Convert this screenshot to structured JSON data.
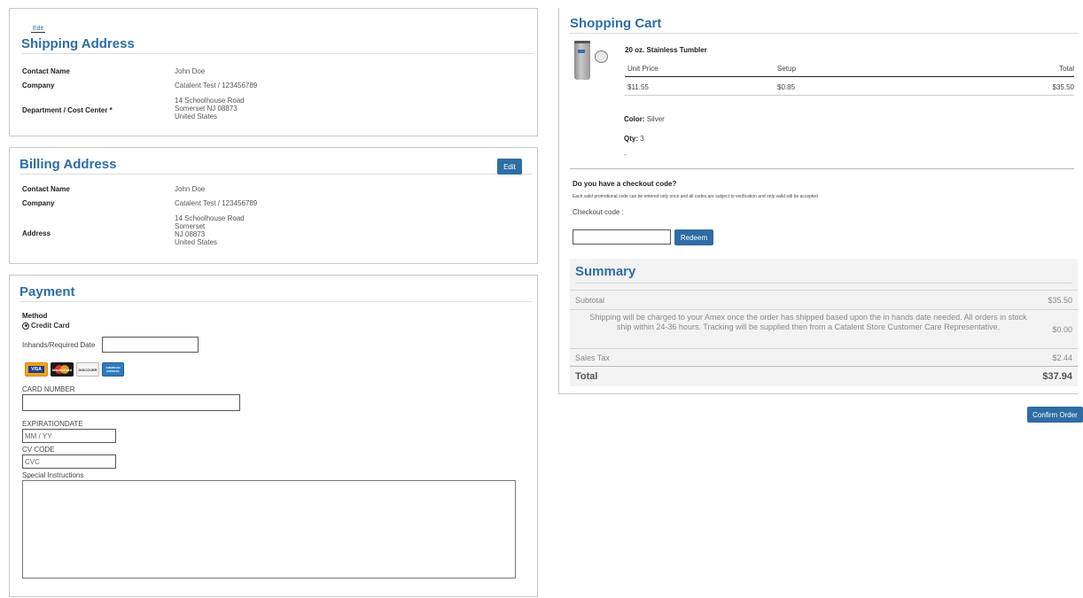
{
  "shipping": {
    "edit_label": "Edit",
    "title": "Shipping Address",
    "contact_label": "Contact Name",
    "contact_value": "John Doe",
    "company_label": "Company",
    "company_value": "Catalent Test / 123456789",
    "dept_label": "Department / Cost Center *",
    "address_lines": [
      "14 Schoolhouse Road",
      "Somerset NJ 08873",
      "United States"
    ]
  },
  "billing": {
    "title": "Billing Address",
    "edit_label": "Edit",
    "contact_label": "Contact Name",
    "contact_value": "John Doe",
    "company_label": "Company",
    "company_value": "Catalent Test / 123456789",
    "address_label": "Address",
    "address_lines": [
      "14 Schoolhouse Road",
      "Somerset",
      "NJ 08873",
      "United States"
    ]
  },
  "payment": {
    "title": "Payment",
    "method_label": "Method",
    "method_value": "Credit Card",
    "inhands_label": "Inhands/Required Date",
    "cards": [
      "VISA",
      "MasterCard",
      "DISCOVER",
      "AMERICAN EXPRESS"
    ],
    "card_number_label": "CARD NUMBER",
    "expiration_label": "EXPIRATIONDATE",
    "expiration_placeholder": "MM / YY",
    "cv_label": "CV CODE",
    "cv_placeholder": "CVC",
    "instructions_label": "Special Instructions"
  },
  "cart": {
    "title": "Shopping Cart",
    "product_name": "20 oz. Stainless Tumbler",
    "col_unit": "Unit Price",
    "col_setup": "Setup",
    "col_total": "Total",
    "unit_price": "$11.55",
    "setup": "$0.85",
    "total": "$35.50",
    "color_label": "Color:",
    "color_value": "Silver",
    "qty_label": "Qty:",
    "qty_value": "3",
    "dash": "-",
    "checkout_question": "Do you have a checkout code?",
    "checkout_note": "Each valid promotional code can be entered only once and all codes are subject to verification and only valid will be accepted",
    "checkout_label": "Checkout code :",
    "redeem_label": "Redeem"
  },
  "summary": {
    "title": "Summary",
    "subtotal_label": "Subtotal",
    "subtotal_value": "$35.50",
    "shipping_note": "Shipping will be charged to your Amex once the order has shipped based upon the in hands date needed. All orders in stock ship within 24-36 hours. Tracking will be supplied then from a Catalent Store Customer Care Representative.",
    "shipping_value": "$0.00",
    "tax_label": "Sales Tax",
    "tax_value": "$2.44",
    "total_label": "Total",
    "total_value": "$37.94"
  },
  "confirm_label": "Confirm Order",
  "colors": {
    "accent": "#2e6da4",
    "border": "#c8c8c8"
  }
}
